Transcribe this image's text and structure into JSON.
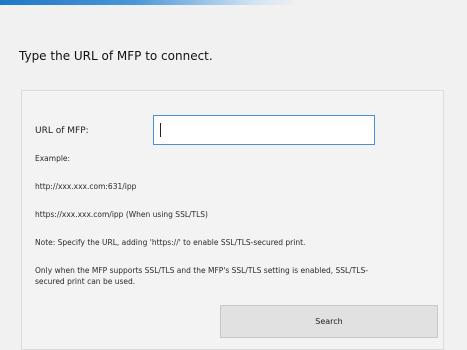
{
  "dialog": {
    "instruction": "Type the URL of MFP to connect."
  },
  "form": {
    "url_label": "URL of MFP:",
    "url_value": "",
    "example_heading": "Example:",
    "example_http": "http://xxx.xxx.com:631/ipp",
    "example_https": "https://xxx.xxx.com/ipp (When using SSL/TLS)",
    "note": "Note: Specify the URL, adding 'https://' to enable SSL/TLS-secured print.",
    "ssl_notice": "Only when the MFP supports SSL/TLS and the MFP's SSL/TLS setting is enabled, SSL/TLS-secured print can be used.",
    "search_label": "Search"
  },
  "colors": {
    "accent": "#1e78c8",
    "input_border": "#4a8fd4",
    "button_bg": "#e1e1e1",
    "background": "#f1f1f1"
  }
}
